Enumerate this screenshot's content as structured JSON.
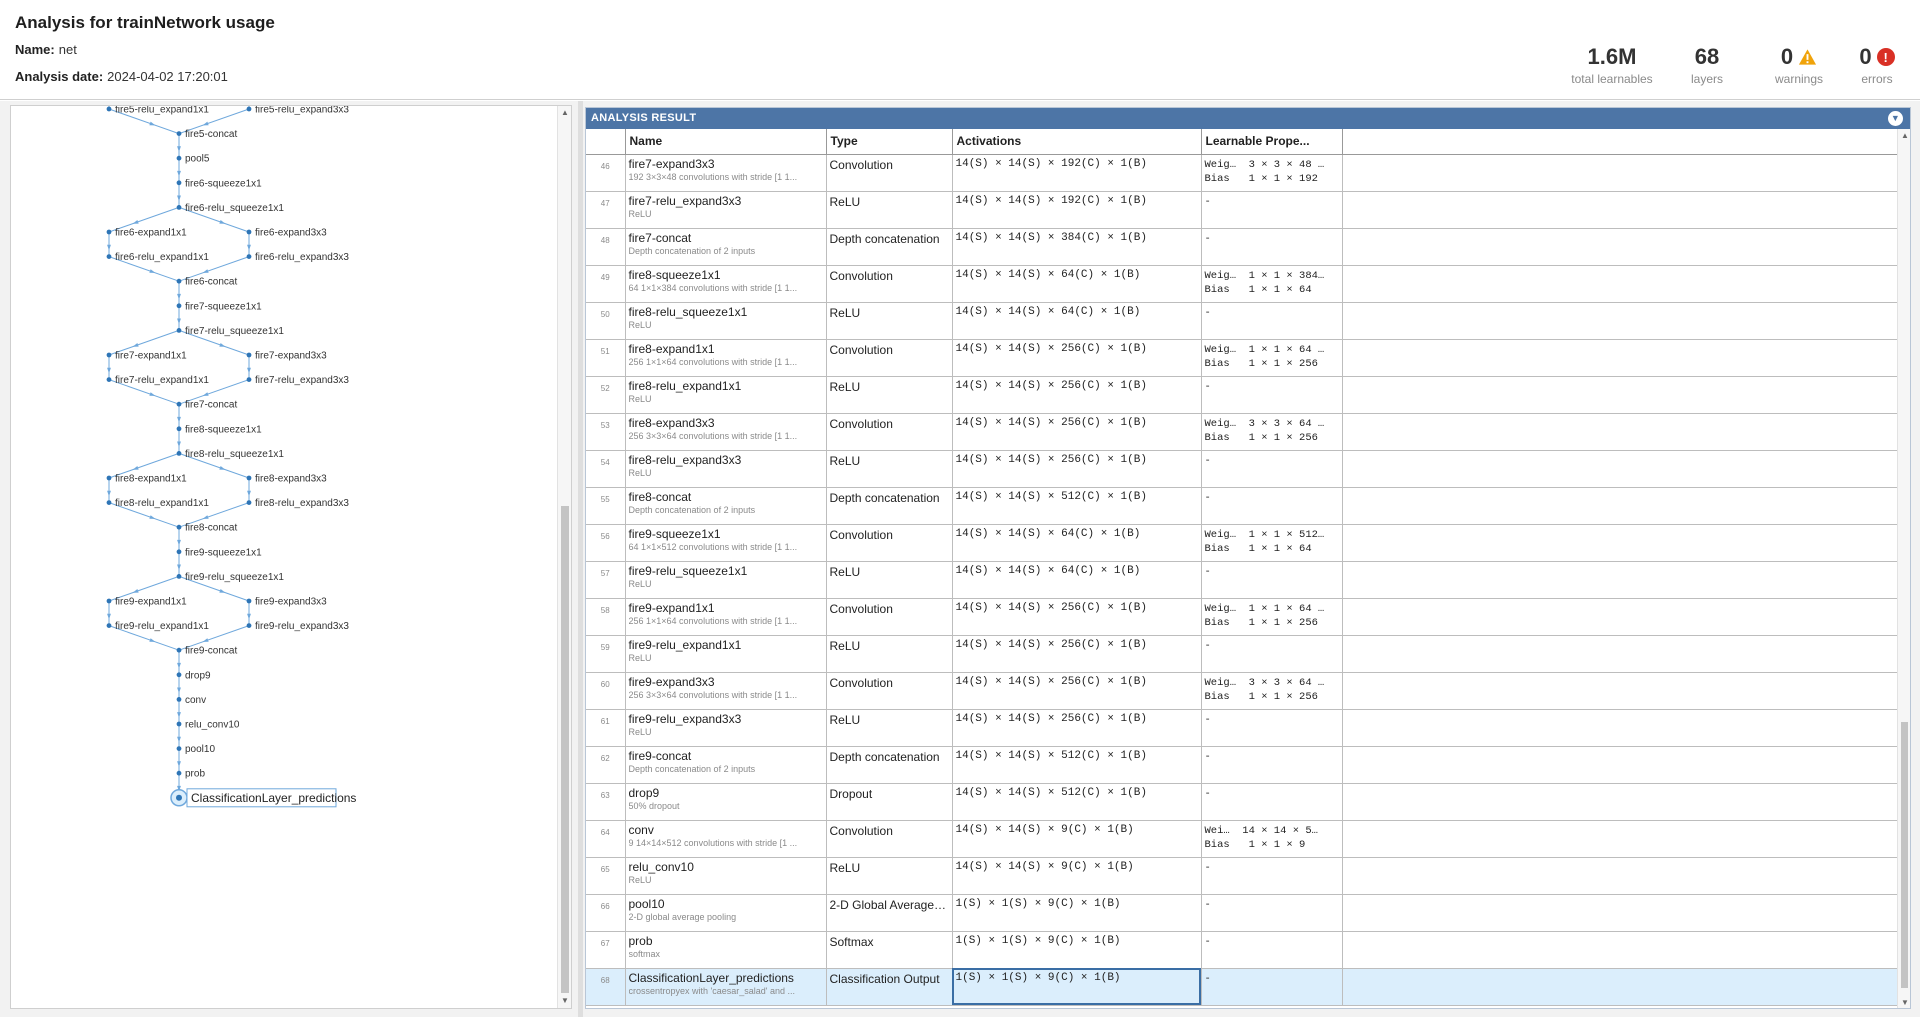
{
  "header": {
    "title": "Analysis for trainNetwork usage",
    "name_label": "Name:",
    "name_value": "net",
    "date_label": "Analysis date:",
    "date_value": "2024-04-02 17:20:01",
    "stats": {
      "learnables": {
        "value": "1.6M",
        "label": "total learnables"
      },
      "layers": {
        "value": "68",
        "label": "layers"
      },
      "warnings": {
        "value": "0",
        "label": "warnings",
        "icon": "warning-icon"
      },
      "errors": {
        "value": "0",
        "label": "errors",
        "icon": "error-icon"
      }
    }
  },
  "graph": {
    "selected_node": "ClassificationLayer_predictions",
    "nodes": [
      "fire5-relu_expand1x1",
      "fire5-relu_expand3x3",
      "fire5-concat",
      "pool5",
      "fire6-squeeze1x1",
      "fire6-relu_squeeze1x1",
      "fire6-expand1x1",
      "fire6-expand3x3",
      "fire6-relu_expand1x1",
      "fire6-relu_expand3x3",
      "fire6-concat",
      "fire7-squeeze1x1",
      "fire7-relu_squeeze1x1",
      "fire7-expand1x1",
      "fire7-expand3x3",
      "fire7-relu_expand1x1",
      "fire7-relu_expand3x3",
      "fire7-concat",
      "fire8-squeeze1x1",
      "fire8-relu_squeeze1x1",
      "fire8-expand1x1",
      "fire8-expand3x3",
      "fire8-relu_expand1x1",
      "fire8-relu_expand3x3",
      "fire8-concat",
      "fire9-squeeze1x1",
      "fire9-relu_squeeze1x1",
      "fire9-expand1x1",
      "fire9-expand3x3",
      "fire9-relu_expand1x1",
      "fire9-relu_expand3x3",
      "fire9-concat",
      "drop9",
      "conv",
      "relu_conv10",
      "pool10",
      "prob",
      "ClassificationLayer_predictions"
    ]
  },
  "result": {
    "title": "ANALYSIS RESULT",
    "columns": [
      "",
      "Name",
      "Type",
      "Activations",
      "Learnable Prope..."
    ],
    "rows": [
      {
        "idx": "46",
        "name": "fire7-expand3x3",
        "desc": "192 3×3×48 convolutions with stride [1 1...",
        "type": "Convolution",
        "act": "14(S) × 14(S) × 192(C) × 1(B)",
        "learn": [
          "Weig…  3 × 3 × 48 …",
          "Bias   1 × 1 × 192"
        ]
      },
      {
        "idx": "47",
        "name": "fire7-relu_expand3x3",
        "desc": "ReLU",
        "type": "ReLU",
        "act": "14(S) × 14(S) × 192(C) × 1(B)",
        "learn": [
          "-"
        ]
      },
      {
        "idx": "48",
        "name": "fire7-concat",
        "desc": "Depth concatenation of 2 inputs",
        "type": "Depth concatenation",
        "act": "14(S) × 14(S) × 384(C) × 1(B)",
        "learn": [
          "-"
        ]
      },
      {
        "idx": "49",
        "name": "fire8-squeeze1x1",
        "desc": "64 1×1×384 convolutions with stride [1 1...",
        "type": "Convolution",
        "act": "14(S) × 14(S) × 64(C) × 1(B)",
        "learn": [
          "Weig…  1 × 1 × 384…",
          "Bias   1 × 1 × 64"
        ]
      },
      {
        "idx": "50",
        "name": "fire8-relu_squeeze1x1",
        "desc": "ReLU",
        "type": "ReLU",
        "act": "14(S) × 14(S) × 64(C) × 1(B)",
        "learn": [
          "-"
        ]
      },
      {
        "idx": "51",
        "name": "fire8-expand1x1",
        "desc": "256 1×1×64 convolutions with stride [1 1...",
        "type": "Convolution",
        "act": "14(S) × 14(S) × 256(C) × 1(B)",
        "learn": [
          "Weig…  1 × 1 × 64 …",
          "Bias   1 × 1 × 256"
        ]
      },
      {
        "idx": "52",
        "name": "fire8-relu_expand1x1",
        "desc": "ReLU",
        "type": "ReLU",
        "act": "14(S) × 14(S) × 256(C) × 1(B)",
        "learn": [
          "-"
        ]
      },
      {
        "idx": "53",
        "name": "fire8-expand3x3",
        "desc": "256 3×3×64 convolutions with stride [1 1...",
        "type": "Convolution",
        "act": "14(S) × 14(S) × 256(C) × 1(B)",
        "learn": [
          "Weig…  3 × 3 × 64 …",
          "Bias   1 × 1 × 256"
        ]
      },
      {
        "idx": "54",
        "name": "fire8-relu_expand3x3",
        "desc": "ReLU",
        "type": "ReLU",
        "act": "14(S) × 14(S) × 256(C) × 1(B)",
        "learn": [
          "-"
        ]
      },
      {
        "idx": "55",
        "name": "fire8-concat",
        "desc": "Depth concatenation of 2 inputs",
        "type": "Depth concatenation",
        "act": "14(S) × 14(S) × 512(C) × 1(B)",
        "learn": [
          "-"
        ]
      },
      {
        "idx": "56",
        "name": "fire9-squeeze1x1",
        "desc": "64 1×1×512 convolutions with stride [1 1...",
        "type": "Convolution",
        "act": "14(S) × 14(S) × 64(C) × 1(B)",
        "learn": [
          "Weig…  1 × 1 × 512…",
          "Bias   1 × 1 × 64"
        ]
      },
      {
        "idx": "57",
        "name": "fire9-relu_squeeze1x1",
        "desc": "ReLU",
        "type": "ReLU",
        "act": "14(S) × 14(S) × 64(C) × 1(B)",
        "learn": [
          "-"
        ]
      },
      {
        "idx": "58",
        "name": "fire9-expand1x1",
        "desc": "256 1×1×64 convolutions with stride [1 1...",
        "type": "Convolution",
        "act": "14(S) × 14(S) × 256(C) × 1(B)",
        "learn": [
          "Weig…  1 × 1 × 64 …",
          "Bias   1 × 1 × 256"
        ]
      },
      {
        "idx": "59",
        "name": "fire9-relu_expand1x1",
        "desc": "ReLU",
        "type": "ReLU",
        "act": "14(S) × 14(S) × 256(C) × 1(B)",
        "learn": [
          "-"
        ]
      },
      {
        "idx": "60",
        "name": "fire9-expand3x3",
        "desc": "256 3×3×64 convolutions with stride [1 1...",
        "type": "Convolution",
        "act": "14(S) × 14(S) × 256(C) × 1(B)",
        "learn": [
          "Weig…  3 × 3 × 64 …",
          "Bias   1 × 1 × 256"
        ]
      },
      {
        "idx": "61",
        "name": "fire9-relu_expand3x3",
        "desc": "ReLU",
        "type": "ReLU",
        "act": "14(S) × 14(S) × 256(C) × 1(B)",
        "learn": [
          "-"
        ]
      },
      {
        "idx": "62",
        "name": "fire9-concat",
        "desc": "Depth concatenation of 2 inputs",
        "type": "Depth concatenation",
        "act": "14(S) × 14(S) × 512(C) × 1(B)",
        "learn": [
          "-"
        ]
      },
      {
        "idx": "63",
        "name": "drop9",
        "desc": "50% dropout",
        "type": "Dropout",
        "act": "14(S) × 14(S) × 512(C) × 1(B)",
        "learn": [
          "-"
        ]
      },
      {
        "idx": "64",
        "name": "conv",
        "desc": "9 14×14×512 convolutions with stride [1 ...",
        "type": "Convolution",
        "act": "14(S) × 14(S) × 9(C) × 1(B)",
        "learn": [
          "Wei…  14 × 14 × 5…",
          "Bias   1 × 1 × 9"
        ]
      },
      {
        "idx": "65",
        "name": "relu_conv10",
        "desc": "ReLU",
        "type": "ReLU",
        "act": "14(S) × 14(S) × 9(C) × 1(B)",
        "learn": [
          "-"
        ]
      },
      {
        "idx": "66",
        "name": "pool10",
        "desc": "2-D global average pooling",
        "type": "2-D Global Average…",
        "act": "1(S) × 1(S) × 9(C) × 1(B)",
        "learn": [
          "-"
        ]
      },
      {
        "idx": "67",
        "name": "prob",
        "desc": "softmax",
        "type": "Softmax",
        "act": "1(S) × 1(S) × 9(C) × 1(B)",
        "learn": [
          "-"
        ]
      },
      {
        "idx": "68",
        "name": "ClassificationLayer_predictions",
        "desc": "crossentropyex with 'caesar_salad' and ...",
        "type": "Classification Output",
        "act": "1(S) × 1(S) × 9(C) × 1(B)",
        "learn": [
          "-"
        ],
        "selected": true
      }
    ]
  },
  "colors": {
    "accent": "#4d75a6",
    "graph_edge": "#6fa8dc",
    "graph_node": "#2e75b6",
    "selected_row": "#dbeefc",
    "warning": "#f0a30a",
    "error": "#d93025"
  }
}
